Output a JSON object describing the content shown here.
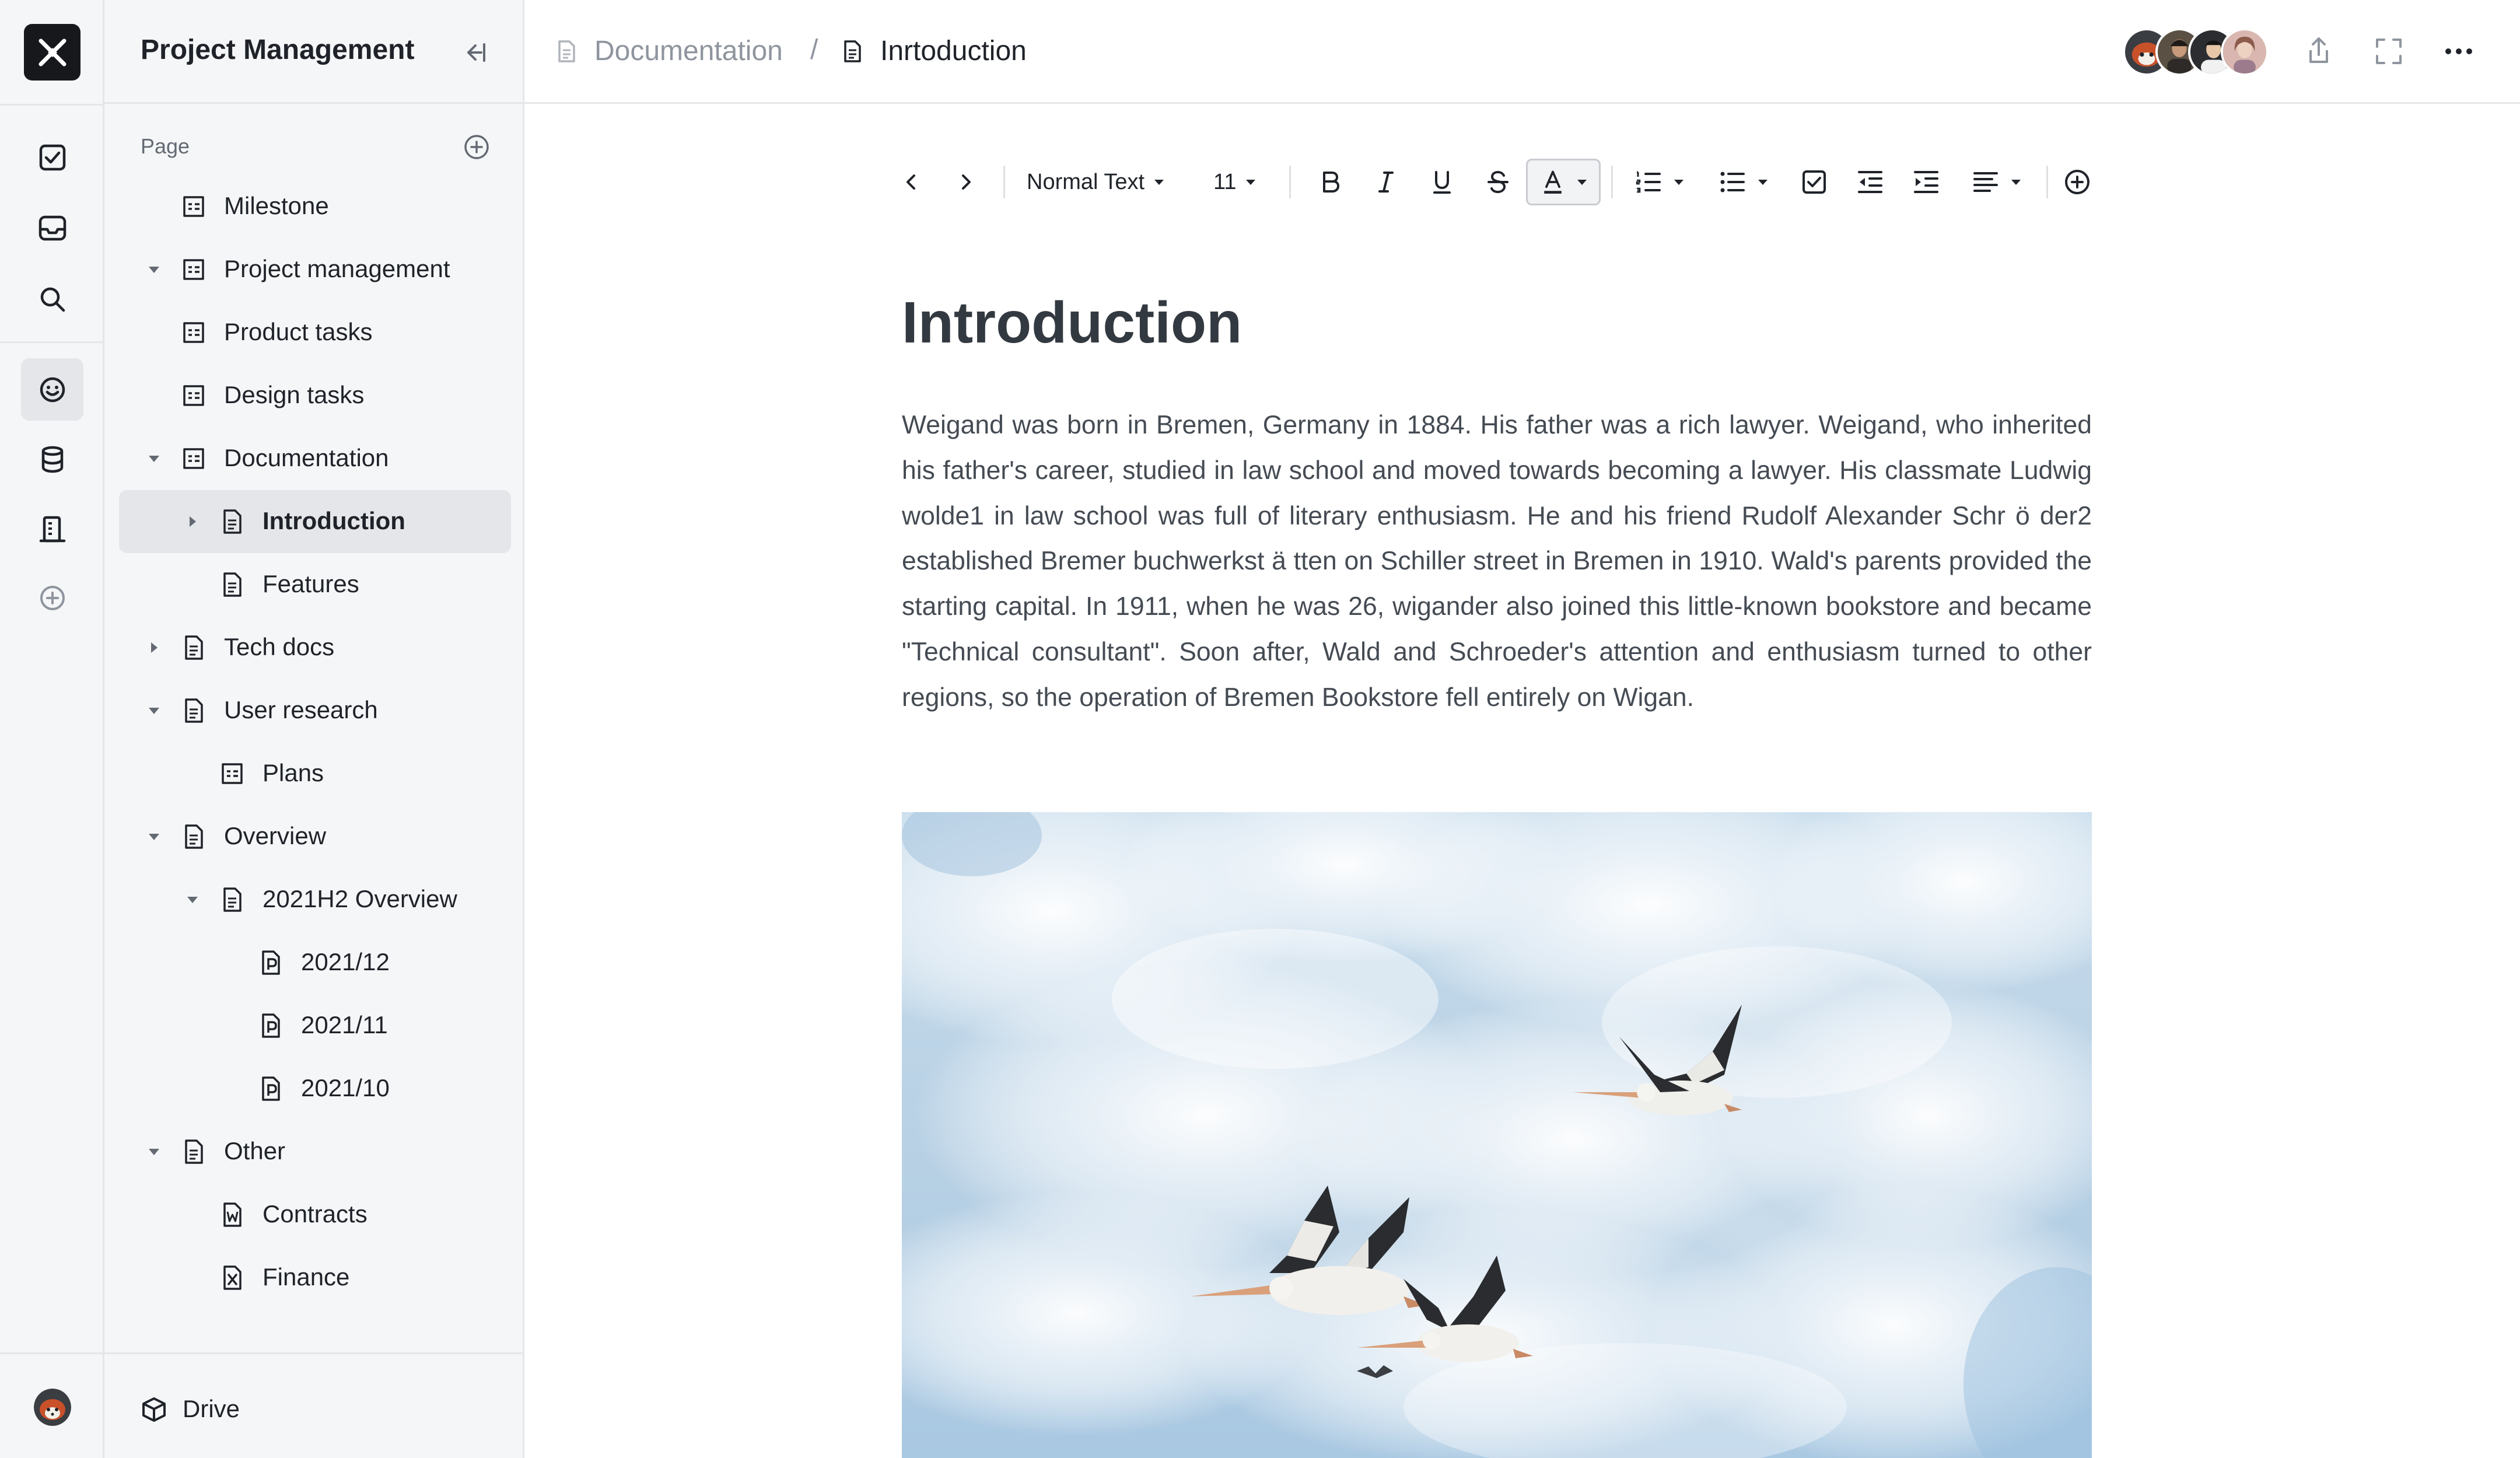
{
  "sidebar": {
    "title": "Project Management",
    "section_label": "Page",
    "items": [
      {
        "label": "Milestone",
        "icon": "table-doc-icon",
        "level": 0,
        "caret": "none"
      },
      {
        "label": "Project management",
        "icon": "table-doc-icon",
        "level": 0,
        "caret": "expanded"
      },
      {
        "label": "Product tasks",
        "icon": "table-doc-icon",
        "level": 0,
        "caret": "none"
      },
      {
        "label": "Design tasks",
        "icon": "table-doc-icon",
        "level": 0,
        "caret": "none"
      },
      {
        "label": "Documentation",
        "icon": "table-doc-icon",
        "level": 0,
        "caret": "expanded"
      },
      {
        "label": "Introduction",
        "icon": "document-icon",
        "level": 1,
        "caret": "collapsed",
        "active": true
      },
      {
        "label": "Features",
        "icon": "document-icon",
        "level": 1,
        "caret": "none"
      },
      {
        "label": "Tech docs",
        "icon": "document-icon",
        "level": 0,
        "caret": "collapsed"
      },
      {
        "label": "User research",
        "icon": "document-icon",
        "level": 0,
        "caret": "expanded"
      },
      {
        "label": "Plans",
        "icon": "table-doc-icon",
        "level": 1,
        "caret": "none"
      },
      {
        "label": "Overview",
        "icon": "document-icon",
        "level": 0,
        "caret": "expanded"
      },
      {
        "label": "2021H2 Overview",
        "icon": "document-icon",
        "level": 1,
        "caret": "expanded"
      },
      {
        "label": "2021/12",
        "icon": "p-file-icon",
        "level": 2,
        "caret": "none"
      },
      {
        "label": "2021/11",
        "icon": "p-file-icon",
        "level": 2,
        "caret": "none"
      },
      {
        "label": "2021/10",
        "icon": "p-file-icon",
        "level": 2,
        "caret": "none"
      },
      {
        "label": "Other",
        "icon": "document-icon",
        "level": 0,
        "caret": "expanded"
      },
      {
        "label": "Contracts",
        "icon": "w-file-icon",
        "level": 1,
        "caret": "none"
      },
      {
        "label": "Finance",
        "icon": "x-file-icon",
        "level": 1,
        "caret": "none"
      }
    ],
    "footer_label": "Drive"
  },
  "breadcrumb": {
    "parent": "Documentation",
    "separator": "/",
    "current": "Inrtoduction"
  },
  "toolbar": {
    "text_style": "Normal Text",
    "font_size": "11"
  },
  "document": {
    "title": "Introduction",
    "body": "Weigand was born in Bremen, Germany in 1884. His father was a rich lawyer. Weigand, who inherited his father's career, studied in law school and moved towards becoming a lawyer. His classmate Ludwig wolde1 in law school was full of literary enthusiasm. He and his friend Rudolf Alexander Schr ö der2 established Bremer buchwerkst ä tten on Schiller street in Bremen in 1910. Wald's parents provided the starting capital. In 1911, when he was 26, wigander also joined this little-known bookstore and became \"Technical consultant\". Soon after, Wald and Schroeder's attention and enthusiasm turned to other regions, so the operation of Bremen Bookstore fell entirely on Wigan."
  },
  "colors": {
    "logo_bg": "#16181b",
    "sidebar_bg": "#f5f6f7",
    "active_item_bg": "#e4e6e9",
    "text_primary": "#1f2329",
    "text_secondary": "#646a73",
    "border": "#e4e6e8",
    "sky": "#b9d4e8"
  }
}
